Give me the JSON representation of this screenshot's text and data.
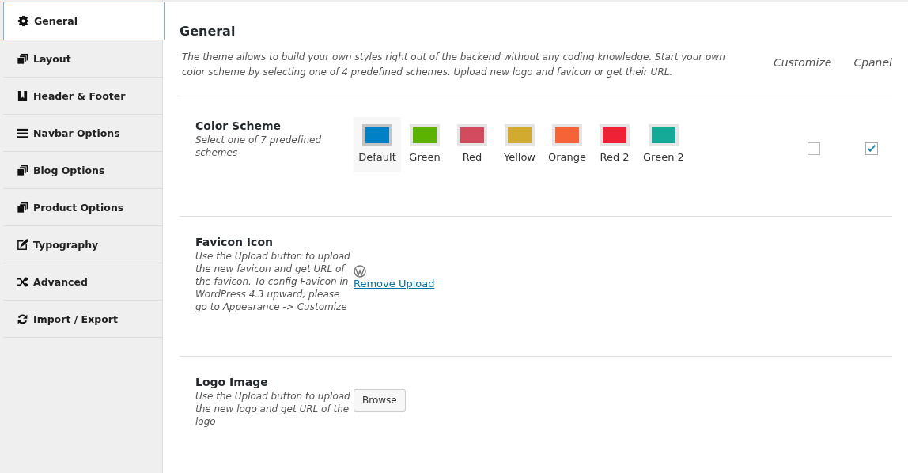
{
  "sidebar": {
    "items": [
      {
        "label": "General",
        "selected": true
      },
      {
        "label": "Layout",
        "selected": false
      },
      {
        "label": "Header & Footer",
        "selected": false
      },
      {
        "label": "Navbar Options",
        "selected": false
      },
      {
        "label": "Blog Options",
        "selected": false
      },
      {
        "label": "Product Options",
        "selected": false
      },
      {
        "label": "Typography",
        "selected": false
      },
      {
        "label": "Advanced",
        "selected": false
      },
      {
        "label": "Import / Export",
        "selected": false
      }
    ]
  },
  "page": {
    "title": "General",
    "description": "The theme allows to build your own styles right out of the backend without any coding knowledge. Start your own color scheme by selecting one of 4 predefined schemes. Upload new logo and favicon or get their URL.",
    "columns": [
      "Customize",
      "Cpanel"
    ]
  },
  "sections": [
    {
      "kind": "colors",
      "title": "Color Scheme",
      "hint": "Select one of 7 predefined schemes",
      "swatches": [
        {
          "label": "Default",
          "color": "#0081c5",
          "selected": true
        },
        {
          "label": "Green",
          "color": "#5bb300",
          "selected": false
        },
        {
          "label": "Red",
          "color": "#d24b5e",
          "selected": false
        },
        {
          "label": "Yellow",
          "color": "#d3aa30",
          "selected": false
        },
        {
          "label": "Orange",
          "color": "#f56337",
          "selected": false
        },
        {
          "label": "Red 2",
          "color": "#ef2135",
          "selected": false
        },
        {
          "label": "Green 2",
          "color": "#13aa98",
          "selected": false
        }
      ],
      "customize": {
        "checked": false
      },
      "cpanel": {
        "checked": true
      }
    },
    {
      "kind": "upload",
      "title": "Favicon Icon",
      "hint": "Use the Upload button to upload the new favicon and get URL of the favicon. To config Favicon in WordPress 4.3 upward, please go to Appearance -> Customize",
      "link": "Remove Upload"
    },
    {
      "kind": "browse",
      "title": "Logo Image",
      "hint": "Use the Upload button to upload the new logo and get URL of the logo",
      "button": "Browse"
    }
  ]
}
